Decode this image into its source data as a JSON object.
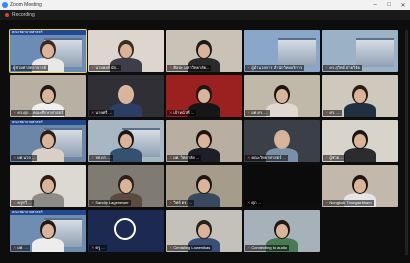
{
  "window": {
    "title": "Zoom Meeting",
    "minimize": "–",
    "maximize": "□",
    "close": "✕"
  },
  "recording": {
    "label": "Recording"
  },
  "banner_text": "คณะพยาบาลศาสตร์",
  "tiles": [
    {
      "label": "ผู้ช่วยศาสตราจารย์",
      "muted": false,
      "active": true
    },
    {
      "label": "นายพงศ์ นัก...",
      "muted": true,
      "active": false
    },
    {
      "label": "ศิลปะ มหาวิทยาลัย...",
      "muted": true,
      "active": false
    },
    {
      "label": "ผู้อำนวยการ สำนักวิทยบริการ",
      "muted": true,
      "active": false
    },
    {
      "label": "ดร.สุวิทย์ ฝ่ายวิจัย",
      "muted": true,
      "active": false
    },
    {
      "label": "ดร.ศุภ... คณะศึกษาศาสตร์",
      "muted": true,
      "active": false
    },
    {
      "label": "นายศรี ...",
      "muted": true,
      "active": false
    },
    {
      "label": "เจ้าหน้าที่ ...",
      "muted": true,
      "active": false
    },
    {
      "label": "ผศ.ดร. ...",
      "muted": true,
      "active": false
    },
    {
      "label": "ดร. ...",
      "muted": true,
      "active": false
    },
    {
      "label": "ผศ.นวล ...",
      "muted": true,
      "active": false
    },
    {
      "label": "รศ.ดร. ...",
      "muted": true,
      "active": false
    },
    {
      "label": "ผศ. วิทยาลัย ...",
      "muted": true,
      "active": false
    },
    {
      "label": "คณะวิทยาศาสตร์ ...",
      "muted": true,
      "active": false
    },
    {
      "label": "ผู้ช่วย ...",
      "muted": true,
      "active": false
    },
    {
      "label": "ครูทวี ...",
      "muted": true,
      "active": false
    },
    {
      "label": "Sandip Lagenewer",
      "muted": true,
      "active": false
    },
    {
      "label": "วิทย์ ดร. ...",
      "muted": true,
      "active": false
    },
    {
      "label": "ศุภ ...",
      "muted": true,
      "active": false
    },
    {
      "label": "Nongkok Thongsiritham",
      "muted": true,
      "active": false
    },
    {
      "label": "ผศ. ...",
      "muted": true,
      "active": false
    },
    {
      "label": "ครู ...",
      "muted": true,
      "active": false
    },
    {
      "label": "Centaling Lowenikas",
      "muted": true,
      "active": false
    },
    {
      "label": "Connecting to audio",
      "muted": true,
      "active": false
    }
  ]
}
